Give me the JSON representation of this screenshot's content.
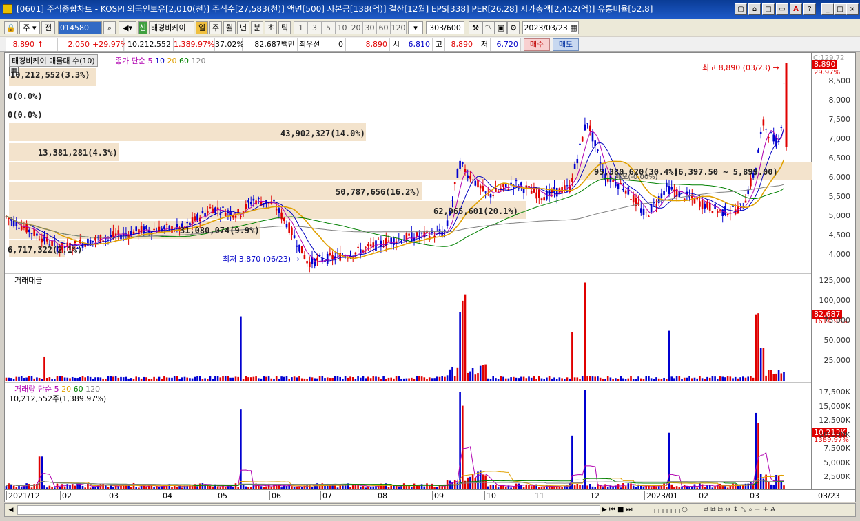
{
  "window": {
    "title": "[0601] 주식종합차트 - KOSPI 외국인보유[2,010(천)] 주식수[27,583(천)] 액면[500] 자본금[138(억)] 결산[12월] EPS[338] PER[26.28] 시가총액[2,452(억)] 유통비율[52.8]",
    "controls": [
      "▢",
      "⌂",
      "□",
      "▭",
      "A",
      "?",
      "_",
      "□",
      "X"
    ]
  },
  "toolbar": {
    "market": "주",
    "market2": "전",
    "code": "014580",
    "company": "태경비케이",
    "badge": "신",
    "periods": [
      "일",
      "주",
      "월",
      "년",
      "분",
      "초",
      "틱"
    ],
    "active_period": "일",
    "numbers": [
      "1",
      "3",
      "5",
      "10",
      "20",
      "30",
      "60",
      "120"
    ],
    "count": "303",
    "count_total": "/600",
    "date": "2023/03/23"
  },
  "quote": {
    "price": "8,890",
    "arrow": "↑",
    "change": "2,050",
    "change_pct": "+29.97%",
    "volume": "10,212,552",
    "volume_pct": "1,389.97%",
    "turnover": "37.02%",
    "amount": "82,687백만",
    "pref_label": "최우선",
    "pref_value": "0",
    "pref_price": "8,890",
    "open_label": "시",
    "open": "6,810",
    "high_label": "고",
    "high": "8,890",
    "low_label": "저",
    "low": "6,720",
    "buy": "매수",
    "sell": "매도"
  },
  "price_panel": {
    "header_name": "태경비케이 매물대 수(10)",
    "ma_label": "종가 단순",
    "ma_periods": [
      "5",
      "10",
      "20",
      "60",
      "120"
    ],
    "ma_colors": [
      "#b000b0",
      "#0000c0",
      "#e0a000",
      "#008000",
      "#808080"
    ],
    "volume_profile": [
      "10,212,552(3.3%)",
      "0(0.0%)",
      "0(0.0%)",
      "43,902,327(14.0%)",
      "13,381,281(4.3%)",
      "95,380,620(30.4%)",
      "50,787,656(16.2%)",
      "62,965,601(20.1%)",
      "31,080,074(9.9%)",
      "6,717,322(2.1%)"
    ],
    "max_label": "최고 8,890 (03/23) →",
    "min_label": "최저 3,870 (06/23) →",
    "range_label": "(6,397.50 ~ 5,899.00)",
    "sale_label": "매도(-0.00%)",
    "y_ticks": [
      "8,500",
      "8,000",
      "7,500",
      "7,000",
      "6,500",
      "6,000",
      "5,500",
      "5,000",
      "4,500",
      "4,000"
    ],
    "current_tag": "8,890",
    "current_pct": "29.97%",
    "top_tag": "C:129.72"
  },
  "amount_panel": {
    "title": "거래대금",
    "y_ticks": [
      "125,000",
      "100,000",
      "75,000",
      "50,000",
      "25,000"
    ],
    "current_tag": "82,687",
    "current_pct": "1614.98%"
  },
  "volume_panel": {
    "title": "거래량",
    "ma_label": "단순",
    "ma_periods": [
      "5",
      "20",
      "60",
      "120"
    ],
    "ma_colors": [
      "#b000b0",
      "#e0a000",
      "#008000",
      "#808080"
    ],
    "subtitle": "10,212,552주(1,389.97%)",
    "y_ticks": [
      "17,500K",
      "15,000K",
      "12,500K",
      "10,000K",
      "7,500K",
      "5,000K",
      "2,500K"
    ],
    "current_tag": "10,213K",
    "current_pct": "1389.97%"
  },
  "x_axis": [
    "2021/12",
    "02",
    "03",
    "04",
    "05",
    "06",
    "07",
    "08",
    "09",
    "10",
    "11",
    "12",
    "2023/01",
    "02",
    "03"
  ],
  "x_axis_right": "03/23",
  "chart_data": {
    "type": "candlestick",
    "price_range": [
      3750,
      8900
    ],
    "ohlc_close_approx": [
      [
        "2021/12",
        5100
      ],
      [
        "01",
        4400
      ],
      [
        "02",
        4500
      ],
      [
        "03",
        4700
      ],
      [
        "04",
        5200
      ],
      [
        "05",
        5400
      ],
      [
        "06",
        4600
      ],
      [
        "07",
        4000
      ],
      [
        "08",
        4400
      ],
      [
        "09",
        4800
      ],
      [
        "09b",
        6000
      ],
      [
        "10",
        5800
      ],
      [
        "11",
        6000
      ],
      [
        "11b",
        7100
      ],
      [
        "12",
        6000
      ],
      [
        "2023/01",
        5500
      ],
      [
        "02",
        5200
      ],
      [
        "03",
        6900
      ],
      [
        "03/23",
        8890
      ]
    ],
    "max": {
      "value": 8890,
      "date": "03/23"
    },
    "min": {
      "value": 3870,
      "date": "06/23"
    }
  }
}
